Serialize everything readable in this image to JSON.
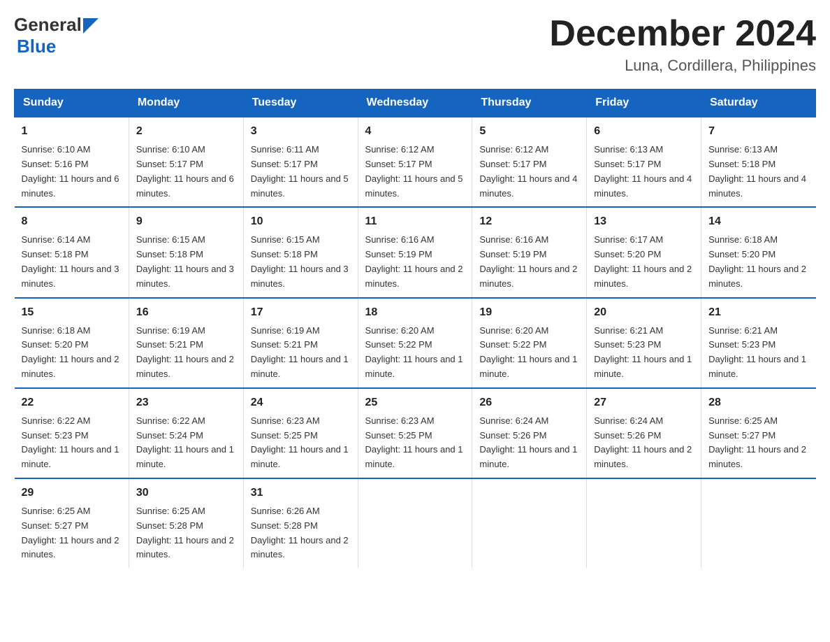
{
  "header": {
    "logo_general": "General",
    "logo_blue": "Blue",
    "month_title": "December 2024",
    "location": "Luna, Cordillera, Philippines"
  },
  "days_of_week": [
    "Sunday",
    "Monday",
    "Tuesday",
    "Wednesday",
    "Thursday",
    "Friday",
    "Saturday"
  ],
  "weeks": [
    [
      {
        "day": "1",
        "sunrise": "6:10 AM",
        "sunset": "5:16 PM",
        "daylight": "11 hours and 6 minutes."
      },
      {
        "day": "2",
        "sunrise": "6:10 AM",
        "sunset": "5:17 PM",
        "daylight": "11 hours and 6 minutes."
      },
      {
        "day": "3",
        "sunrise": "6:11 AM",
        "sunset": "5:17 PM",
        "daylight": "11 hours and 5 minutes."
      },
      {
        "day": "4",
        "sunrise": "6:12 AM",
        "sunset": "5:17 PM",
        "daylight": "11 hours and 5 minutes."
      },
      {
        "day": "5",
        "sunrise": "6:12 AM",
        "sunset": "5:17 PM",
        "daylight": "11 hours and 4 minutes."
      },
      {
        "day": "6",
        "sunrise": "6:13 AM",
        "sunset": "5:17 PM",
        "daylight": "11 hours and 4 minutes."
      },
      {
        "day": "7",
        "sunrise": "6:13 AM",
        "sunset": "5:18 PM",
        "daylight": "11 hours and 4 minutes."
      }
    ],
    [
      {
        "day": "8",
        "sunrise": "6:14 AM",
        "sunset": "5:18 PM",
        "daylight": "11 hours and 3 minutes."
      },
      {
        "day": "9",
        "sunrise": "6:15 AM",
        "sunset": "5:18 PM",
        "daylight": "11 hours and 3 minutes."
      },
      {
        "day": "10",
        "sunrise": "6:15 AM",
        "sunset": "5:18 PM",
        "daylight": "11 hours and 3 minutes."
      },
      {
        "day": "11",
        "sunrise": "6:16 AM",
        "sunset": "5:19 PM",
        "daylight": "11 hours and 2 minutes."
      },
      {
        "day": "12",
        "sunrise": "6:16 AM",
        "sunset": "5:19 PM",
        "daylight": "11 hours and 2 minutes."
      },
      {
        "day": "13",
        "sunrise": "6:17 AM",
        "sunset": "5:20 PM",
        "daylight": "11 hours and 2 minutes."
      },
      {
        "day": "14",
        "sunrise": "6:18 AM",
        "sunset": "5:20 PM",
        "daylight": "11 hours and 2 minutes."
      }
    ],
    [
      {
        "day": "15",
        "sunrise": "6:18 AM",
        "sunset": "5:20 PM",
        "daylight": "11 hours and 2 minutes."
      },
      {
        "day": "16",
        "sunrise": "6:19 AM",
        "sunset": "5:21 PM",
        "daylight": "11 hours and 2 minutes."
      },
      {
        "day": "17",
        "sunrise": "6:19 AM",
        "sunset": "5:21 PM",
        "daylight": "11 hours and 1 minute."
      },
      {
        "day": "18",
        "sunrise": "6:20 AM",
        "sunset": "5:22 PM",
        "daylight": "11 hours and 1 minute."
      },
      {
        "day": "19",
        "sunrise": "6:20 AM",
        "sunset": "5:22 PM",
        "daylight": "11 hours and 1 minute."
      },
      {
        "day": "20",
        "sunrise": "6:21 AM",
        "sunset": "5:23 PM",
        "daylight": "11 hours and 1 minute."
      },
      {
        "day": "21",
        "sunrise": "6:21 AM",
        "sunset": "5:23 PM",
        "daylight": "11 hours and 1 minute."
      }
    ],
    [
      {
        "day": "22",
        "sunrise": "6:22 AM",
        "sunset": "5:23 PM",
        "daylight": "11 hours and 1 minute."
      },
      {
        "day": "23",
        "sunrise": "6:22 AM",
        "sunset": "5:24 PM",
        "daylight": "11 hours and 1 minute."
      },
      {
        "day": "24",
        "sunrise": "6:23 AM",
        "sunset": "5:25 PM",
        "daylight": "11 hours and 1 minute."
      },
      {
        "day": "25",
        "sunrise": "6:23 AM",
        "sunset": "5:25 PM",
        "daylight": "11 hours and 1 minute."
      },
      {
        "day": "26",
        "sunrise": "6:24 AM",
        "sunset": "5:26 PM",
        "daylight": "11 hours and 1 minute."
      },
      {
        "day": "27",
        "sunrise": "6:24 AM",
        "sunset": "5:26 PM",
        "daylight": "11 hours and 2 minutes."
      },
      {
        "day": "28",
        "sunrise": "6:25 AM",
        "sunset": "5:27 PM",
        "daylight": "11 hours and 2 minutes."
      }
    ],
    [
      {
        "day": "29",
        "sunrise": "6:25 AM",
        "sunset": "5:27 PM",
        "daylight": "11 hours and 2 minutes."
      },
      {
        "day": "30",
        "sunrise": "6:25 AM",
        "sunset": "5:28 PM",
        "daylight": "11 hours and 2 minutes."
      },
      {
        "day": "31",
        "sunrise": "6:26 AM",
        "sunset": "5:28 PM",
        "daylight": "11 hours and 2 minutes."
      },
      null,
      null,
      null,
      null
    ]
  ]
}
